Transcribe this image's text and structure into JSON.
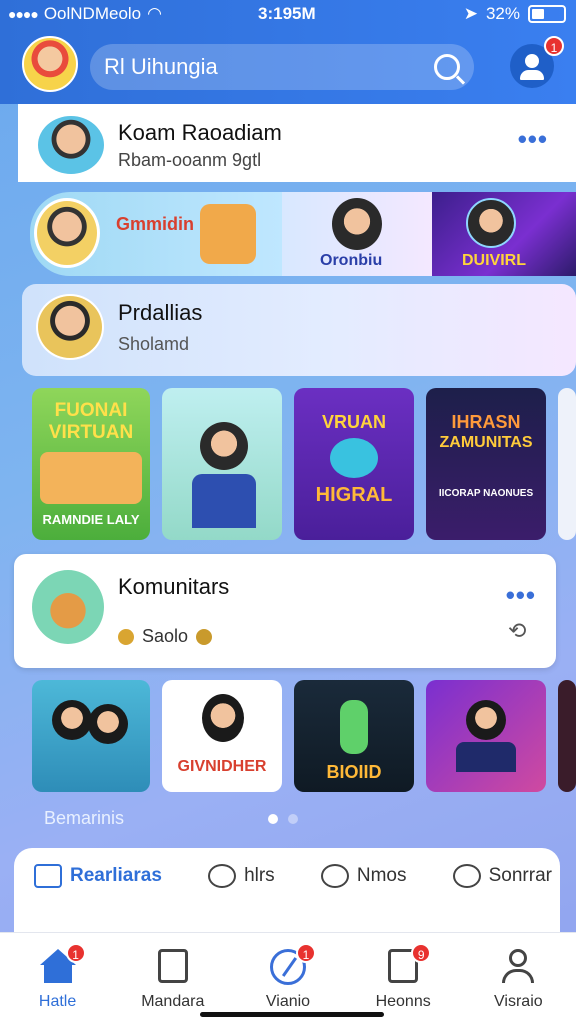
{
  "status": {
    "carrier": "OolNDMeolo",
    "time": "3:195M",
    "battery": "32%"
  },
  "header": {
    "search_text": "Rl Uihungia",
    "notification_count": "1"
  },
  "top_card": {
    "name": "Koam Raoadiam",
    "subtitle": "Rbam-ooanm 9gtl"
  },
  "banners": [
    {
      "label": "Gmmidin"
    },
    {
      "label": "Oronbiu"
    },
    {
      "label": "DUIVIRL"
    }
  ],
  "featured": {
    "title": "Prdallias",
    "subtitle": "Sholamd"
  },
  "tiles": [
    {
      "line1": "FUONAI",
      "line2": "VIRTUAN",
      "line3": "RAMNDIE LALY"
    },
    {
      "line1": "",
      "line2": "",
      "line3": ""
    },
    {
      "line1": "VRUAN",
      "line2": "HIGRAL",
      "line3": ""
    },
    {
      "line1": "IHRASN",
      "line2": "ZAMUNITAS",
      "line3": "IICORAP NAONUES"
    }
  ],
  "community": {
    "title": "Komunitars",
    "subtitle": "Saolo"
  },
  "tiles2": [
    {
      "label": ""
    },
    {
      "label": "GIVNIDHER"
    },
    {
      "label": "BIOIID"
    },
    {
      "label": ""
    }
  ],
  "section_label": "Bemarinis",
  "tabs": [
    {
      "label": "Rearliaras"
    },
    {
      "label": "hlrs"
    },
    {
      "label": "Nmos"
    },
    {
      "label": "Sonrrar"
    }
  ],
  "nav": [
    {
      "label": "Hatle",
      "badge": "1"
    },
    {
      "label": "Mandara",
      "badge": ""
    },
    {
      "label": "Vianio",
      "badge": "1"
    },
    {
      "label": "Heonns",
      "badge": "9"
    },
    {
      "label": "Visraio",
      "badge": ""
    }
  ],
  "colors": {
    "accent": "#2f6fd8",
    "badge": "#e8322f",
    "tile_green": "#6cc04a",
    "tile_purple": "#6b2fc2",
    "tile_dark": "#1d1f4a"
  }
}
